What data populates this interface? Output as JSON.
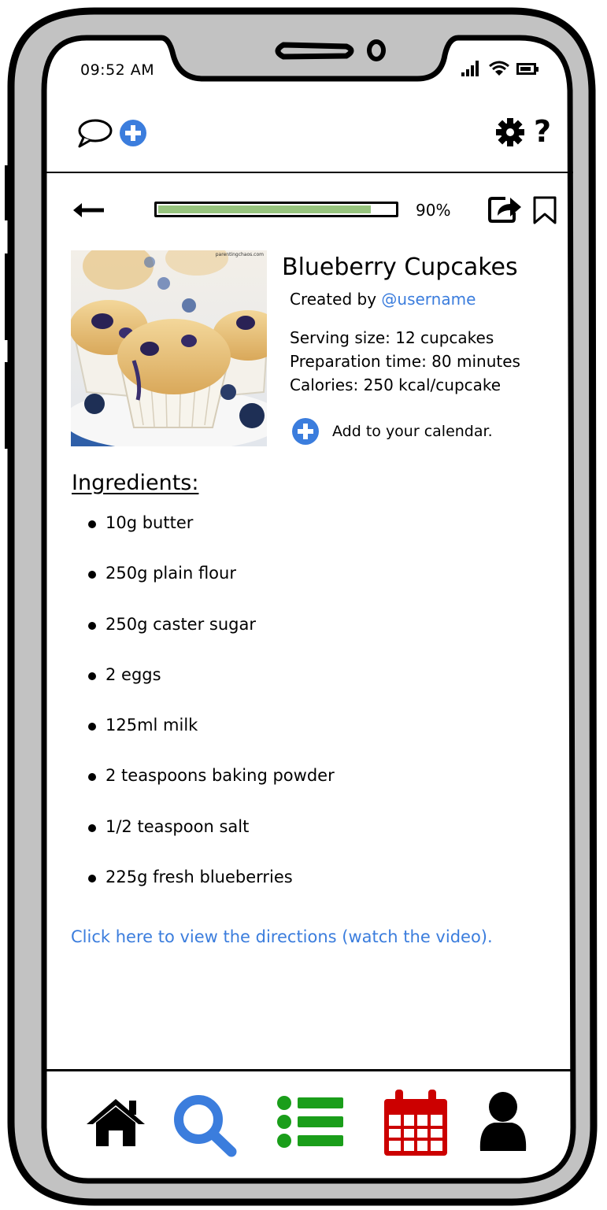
{
  "status_bar": {
    "time": "09:52 AM"
  },
  "reader": {
    "progress_percent": 90,
    "progress_label": "90%"
  },
  "recipe": {
    "title": "Blueberry Cupcakes",
    "created_by_prefix": "Created by ",
    "username": "@username",
    "serving_size": "Serving size: 12 cupcakes",
    "preparation_time": "Preparation time: 80 minutes",
    "calories": "Calories: 250 kcal/cupcake",
    "add_to_calendar": "Add to your calendar.",
    "photo_watermark": "parentingchaos.com"
  },
  "ingredients_heading": "Ingredients:",
  "ingredients": [
    "10g butter",
    "250g plain flour",
    "250g caster sugar",
    "2 eggs",
    "125ml milk",
    "2 teaspoons baking powder",
    "1/2 teaspoon salt",
    "225g fresh blueberries"
  ],
  "directions_link": "Click here to view the directions (watch the video).",
  "icons": {
    "chat": "chat-bubble-icon",
    "add": "plus-circle-icon",
    "settings": "gear-icon",
    "help": "question-mark-icon",
    "back": "arrow-left-icon",
    "share": "share-icon",
    "bookmark": "bookmark-icon",
    "home": "home-icon",
    "search": "search-icon",
    "list": "list-icon",
    "calendar": "calendar-icon",
    "profile": "user-icon"
  },
  "colors": {
    "accent_blue": "#3b7ddd",
    "progress_green": "#97c47e",
    "list_green": "#1a9e1a",
    "calendar_red": "#cc0000",
    "frame_gray": "#c2c2c2"
  }
}
